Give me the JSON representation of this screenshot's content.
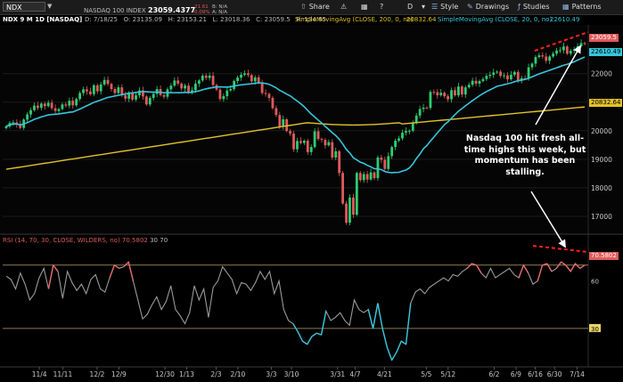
{
  "toolbar": {
    "symbol": "NDX",
    "share_label": "Share",
    "d_label": "D",
    "style_label": "Style",
    "drawings_label": "Drawings",
    "studies_label": "Studies",
    "patterns_label": "Patterns"
  },
  "header": {
    "title": "NDX 9 M 1D [NASDAQ]",
    "index_name": "NASDAQ 100 INDEX",
    "last_price": "23059.4377",
    "change": "-21.61",
    "change_pct": "-0.09%",
    "bid": "B: N/A",
    "ask": "A: N/A",
    "ohlc": "D: 7/18/25   O: 23135.09   H: 23153.21   L: 23018.36   C: 23059.5   R: 134.85",
    "sma200_label": "SimpleMovingAvg (CLOSE, 200, 0, no)",
    "sma200_value": "20832.64",
    "sma20_label": "SimpleMovingAvg (CLOSE, 20, 0, no)",
    "sma20_value": "22610.49"
  },
  "rsi": {
    "label": "RSI (14, 70, 30, CLOSE, WILDERS, no)",
    "value": "70.5802",
    "levels": [
      "30",
      "70"
    ]
  },
  "annotation": "Nasdaq 100 hit fresh all-time highs this week, but momentum has been stalling.",
  "colors": {
    "up": "#2ecc71",
    "down": "#e05a5a",
    "sma20": "#37c6dc",
    "sma200": "#e2c22b",
    "rsi": "#9a9a9a",
    "rsi_overbought": "#e86a6a",
    "rsi_oversold": "#37c6dc",
    "trendline": "#ff2020"
  },
  "chart_data": {
    "type": "candlestick",
    "price_axis": {
      "ticks": [
        "17000",
        "18000",
        "19000",
        "20000",
        "21000",
        "22000"
      ],
      "ylim": [
        16500,
        23550
      ],
      "value_labels": [
        "23059.5",
        "22610.49",
        "20832.64"
      ]
    },
    "rsi_axis": {
      "ticks": [
        "30",
        "70",
        "60"
      ],
      "ylim": [
        8,
        80
      ]
    },
    "x_ticks": [
      "11/4",
      "11/11",
      "12/2",
      "12/9",
      "12/30",
      "1/13",
      "2/3",
      "2/10",
      "3/3",
      "3/10",
      "3/31",
      "4/7",
      "4/21",
      "5/5",
      "5/12",
      "6/2",
      "6/9",
      "6/16",
      "6/30",
      "7/14"
    ],
    "closes": [
      20150,
      20270,
      20290,
      20220,
      20100,
      20390,
      20570,
      20720,
      20880,
      20800,
      20950,
      20860,
      20980,
      20790,
      20690,
      20760,
      20920,
      20880,
      21050,
      20890,
      21110,
      21320,
      21450,
      21380,
      21280,
      21590,
      21380,
      21620,
      21780,
      21640,
      21460,
      21320,
      21520,
      21240,
      21120,
      21340,
      21090,
      21240,
      21410,
      21200,
      20920,
      21150,
      21290,
      21460,
      21250,
      21190,
      21450,
      21580,
      21760,
      21650,
      21480,
      21580,
      21340,
      21420,
      21650,
      21760,
      21930,
      21850,
      21930,
      21600,
      21440,
      21110,
      21210,
      21410,
      21460,
      21740,
      21860,
      21960,
      22010,
      21950,
      21730,
      21870,
      21680,
      21320,
      21290,
      21150,
      20790,
      20550,
      20150,
      20400,
      19990,
      19900,
      19350,
      19640,
      19570,
      19650,
      19250,
      19430,
      19980,
      19710,
      19680,
      19490,
      19600,
      19060,
      19280,
      18520,
      17450,
      16780,
      17660,
      17060,
      18520,
      18270,
      18480,
      18290,
      18540,
      18340,
      19060,
      18980,
      18660,
      19110,
      19430,
      19650,
      19730,
      19930,
      19990,
      20000,
      20290,
      20530,
      20760,
      20810,
      20800,
      21360,
      21350,
      21240,
      21330,
      21210,
      21100,
      21420,
      21240,
      21550,
      21270,
      21520,
      21610,
      21750,
      21650,
      21740,
      21810,
      21920,
      21960,
      22040,
      22070,
      21920,
      21940,
      21800,
      21960,
      22060,
      21770,
      21840,
      21820,
      22220,
      22350,
      22580,
      22640,
      22600,
      22450,
      22600,
      22700,
      22810,
      22820,
      22950,
      22700,
      22800,
      22850,
      22960,
      23070,
      23060
    ],
    "series": [
      {
        "name": "RSI (14, 70, 30, CLOSE, WILDERS, no)",
        "values": [
          63,
          61,
          55,
          65,
          58,
          48,
          52,
          62,
          68,
          55,
          70,
          66,
          49,
          66,
          59,
          54,
          58,
          52,
          61,
          64,
          55,
          53,
          62,
          70,
          68,
          69,
          72,
          60,
          48,
          36,
          39,
          45,
          50,
          42,
          47,
          57,
          42,
          38,
          33,
          40,
          57,
          48,
          55,
          37,
          56,
          60,
          69,
          65,
          61,
          52,
          59,
          58,
          54,
          59,
          66,
          61,
          66,
          52,
          60,
          42,
          35,
          33,
          28,
          22,
          20,
          25,
          27,
          26,
          41,
          35,
          37,
          40,
          35,
          32,
          48,
          42,
          40,
          42,
          30,
          46,
          30,
          18,
          10,
          15,
          22,
          20,
          46,
          53,
          55,
          52,
          56,
          58,
          60,
          62,
          60,
          64,
          63,
          66,
          68,
          71,
          70,
          65,
          62,
          68,
          62,
          64,
          66,
          68,
          64,
          62,
          70,
          65,
          58,
          60,
          70,
          71,
          66,
          68,
          72,
          70,
          66,
          71,
          68,
          70
        ]
      }
    ]
  }
}
